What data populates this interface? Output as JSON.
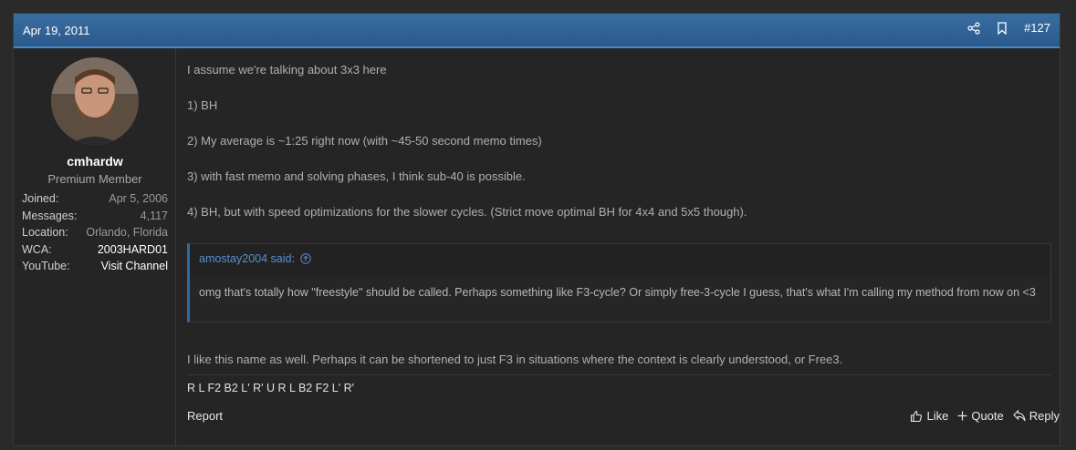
{
  "post": {
    "date": "Apr 19, 2011",
    "number": "#127",
    "icons": {
      "share": "share-icon",
      "bookmark": "bookmark-icon"
    }
  },
  "author": {
    "avatar": "avatar",
    "username": "cmhardw",
    "title": "Premium Member",
    "stats": [
      {
        "label": "Joined:",
        "value": "Apr 5, 2006"
      },
      {
        "label": "Messages:",
        "value": "4,117"
      },
      {
        "label": "Location:",
        "value": "Orlando, Florida"
      },
      {
        "label": "WCA:",
        "value": "2003HARD01"
      },
      {
        "label": "YouTube:",
        "value": "Visit Channel"
      }
    ]
  },
  "body": {
    "paragraphs": [
      "I assume we're talking about 3x3 here",
      "1) BH",
      "2) My average is ~1:25 right now (with ~45-50 second memo times)",
      "3) with fast memo and solving phases, I think sub-40 is possible.",
      "4) BH, but with speed optimizations for the slower cycles. (Strict move optimal BH for 4x4 and 5x5 though)."
    ],
    "quote": {
      "author": "amostay2004 said:",
      "text": "omg that's totally how \"freestyle\" should be called. Perhaps something like F3-cycle? Or simply free-3-cycle I guess, that's what I'm calling my method from now on <3"
    },
    "after_quote": "I like this name as well. Perhaps it can be shortened to just F3 in situations where the context is clearly understood, or Free3."
  },
  "signature": "R L F2 B2 L' R' U R L B2 F2 L' R'",
  "footer": {
    "report": "Report",
    "like": "Like",
    "quote": "Quote",
    "reply": "Reply"
  },
  "colors": {
    "header": "#2a5a8c",
    "accent": "#4a86c0",
    "link": "#5a8ed0"
  }
}
